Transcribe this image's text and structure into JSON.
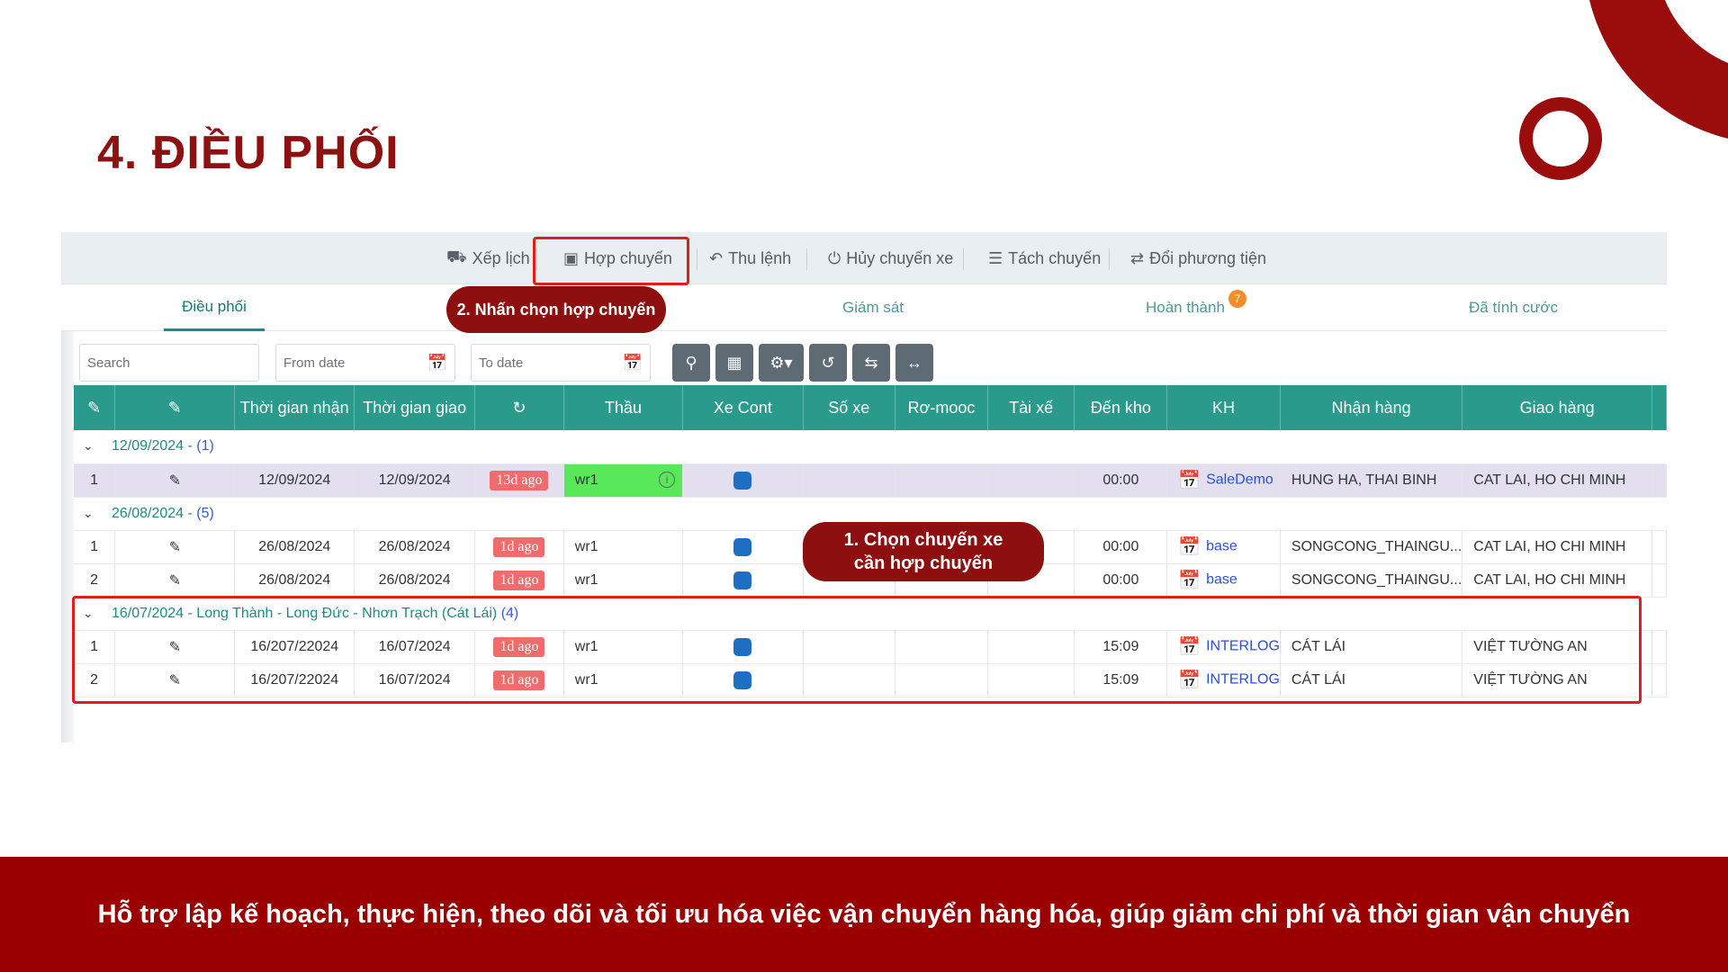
{
  "slide": {
    "title": "4. ĐIỀU PHỐI",
    "footer": "Hỗ trợ lập kế hoạch, thực hiện, theo dõi và tối ưu hóa việc vận chuyển hàng hóa, giúp giảm chi phí và thời gian vận chuyển"
  },
  "toolbar": {
    "items": [
      {
        "label": "Xếp lịch",
        "icon": "car-icon"
      },
      {
        "label": "Hợp chuyến",
        "icon": "truck-icon"
      },
      {
        "label": "Thu lệnh",
        "icon": "reply-icon"
      },
      {
        "label": "Hủy chuyến xe",
        "icon": "power-icon"
      },
      {
        "label": "Tách chuyến",
        "icon": "sliders-icon"
      },
      {
        "label": "Đổi phương tiện",
        "icon": "swap-icon"
      }
    ]
  },
  "tabs": [
    {
      "label": "Điều phối",
      "active": true
    },
    {
      "label": "Giám sát",
      "active": false
    },
    {
      "label": "Hoàn thành",
      "badge": "7",
      "active": false
    },
    {
      "label": "Đã tính cước",
      "active": false
    }
  ],
  "filters": {
    "search_placeholder": "Search",
    "from_placeholder": "From date",
    "to_placeholder": "To date",
    "buttons": [
      "search-icon",
      "calendar-icon",
      "settings-dropdown-icon",
      "undo-icon",
      "repeat-icon",
      "collapse-icon"
    ]
  },
  "table": {
    "headers": [
      "Thời gian nhận",
      "Thời gian giao",
      "Thầu",
      "Xe Cont",
      "Số xe",
      "Rơ-mooc",
      "Tài xế",
      "Đến kho",
      "KH",
      "Nhận hàng",
      "Giao hàng"
    ],
    "groups": [
      {
        "label": "12/09/2024 - ",
        "count": "(1)",
        "rows": [
          {
            "no": "1",
            "recv": "12/09/2024",
            "deliv": "12/09/2024",
            "ago": "13d ago",
            "thau": "wr1",
            "den_kho": "00:00",
            "kh": "SaleDemo",
            "nhan": "HUNG HA, THAI BINH",
            "giao": "CAT LAI, HO CHI MINH"
          }
        ]
      },
      {
        "label": "26/08/2024 - ",
        "count": "(5)",
        "rows": [
          {
            "no": "1",
            "recv": "26/08/2024",
            "deliv": "26/08/2024",
            "ago": "1d ago",
            "thau": "wr1",
            "den_kho": "00:00",
            "kh": "base",
            "nhan": "SONGCONG_THAINGU...",
            "giao": "CAT LAI, HO CHI MINH"
          },
          {
            "no": "2",
            "recv": "26/08/2024",
            "deliv": "26/08/2024",
            "ago": "1d ago",
            "thau": "wr1",
            "den_kho": "00:00",
            "kh": "base",
            "nhan": "SONGCONG_THAINGU...",
            "giao": "CAT LAI, HO CHI MINH"
          }
        ]
      },
      {
        "label": "16/07/2024 - Long Thành - Long Đức - Nhơn Trạch (Cát Lái) ",
        "count": "(4)",
        "rows": [
          {
            "no": "1",
            "recv": "16/207/22024",
            "deliv": "16/07/2024",
            "ago": "1d ago",
            "thau": "wr1",
            "den_kho": "15:09",
            "kh": "INTERLOG",
            "nhan": "CÁT LÁI",
            "giao": "VIỆT TƯỜNG AN"
          },
          {
            "no": "2",
            "recv": "16/207/22024",
            "deliv": "16/07/2024",
            "ago": "1d ago",
            "thau": "wr1",
            "den_kho": "15:09",
            "kh": "INTERLOG",
            "nhan": "CÁT LÁI",
            "giao": "VIỆT TƯỜNG AN"
          }
        ]
      }
    ]
  },
  "callouts": {
    "step2": "2. Nhấn chọn hợp chuyến",
    "step1_line1": "1. Chọn chuyến xe",
    "step1_line2": "cần hợp chuyến"
  },
  "colors": {
    "brand": "#9b0000",
    "table_header": "#2a9a8c",
    "highlight": "#e01d1d",
    "callout": "#8e0f0f"
  }
}
